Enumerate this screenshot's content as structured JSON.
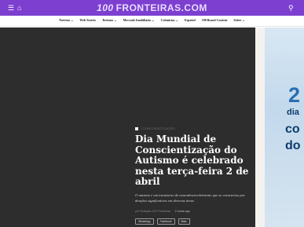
{
  "topbar": {
    "menu_icon": "menu-icon",
    "home_icon": "home-icon",
    "search_icon": "search-icon",
    "logo_number": "100",
    "logo_text": "FRONTEIRAS.COM",
    "accent_color": "#7c3fd0"
  },
  "nav": {
    "items": [
      {
        "label": "Notícias ⌄"
      },
      {
        "label": "Web Stories"
      },
      {
        "label": "Turismo ⌄"
      },
      {
        "label": "Mercado Imobiliário ⌄"
      },
      {
        "label": "Colunistas ⌄"
      },
      {
        "label": "Español"
      },
      {
        "label": "100 Brand Content"
      },
      {
        "label": "Sobre ⌄"
      }
    ]
  },
  "article": {
    "category": "CONSCIENTIZAÇÃO",
    "headline": "Dia Mundial de Conscientização do Autismo é celebrado nesta terça-feira 2 de abril",
    "lead": "O autismo é um transtorno do neurodesenvolvimento que se caracteriza por desafios significativos em diversas áreas",
    "author": "por Redação 100 Fronteiras",
    "time": "2 horas ago",
    "share_buttons": [
      "WhatsApp",
      "Facebook",
      "Mais"
    ]
  },
  "side_banner": {
    "big_number": "2",
    "line1": "dia",
    "line2": "co",
    "line3": "do"
  }
}
